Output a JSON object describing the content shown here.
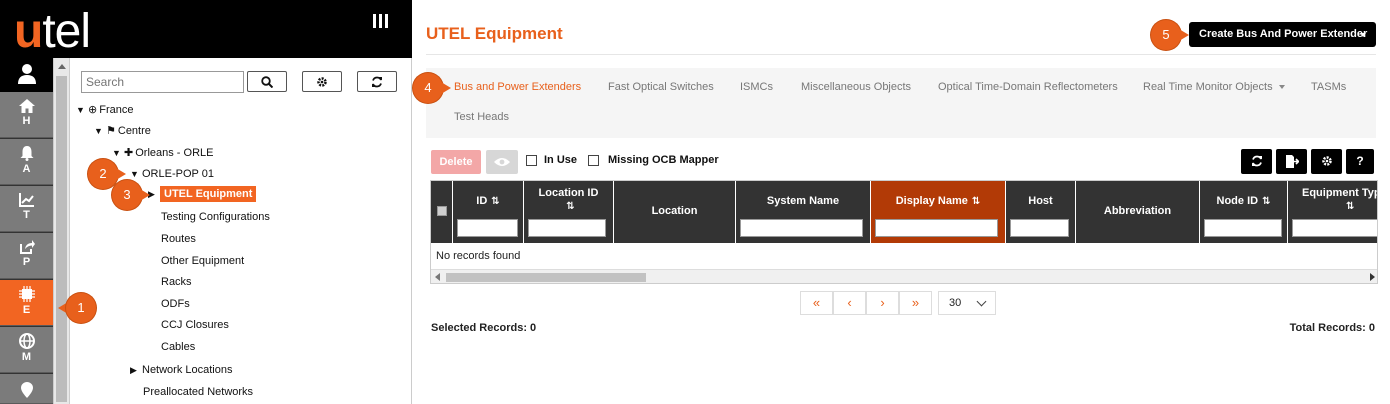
{
  "logo": {
    "u": "u",
    "rest": "tel"
  },
  "rail": {
    "items": [
      {
        "letter": "H",
        "icon": "home-icon",
        "glyph": "⌂"
      },
      {
        "letter": "A",
        "icon": "bell-icon",
        "glyph": "🔔"
      },
      {
        "letter": "T",
        "icon": "chart-icon",
        "glyph": "📈"
      },
      {
        "letter": "P",
        "icon": "share-icon",
        "glyph": "↗"
      },
      {
        "letter": "E",
        "icon": "chip-icon",
        "glyph": "▦"
      },
      {
        "letter": "M",
        "icon": "globe-icon",
        "glyph": "◍"
      },
      {
        "letter": "",
        "icon": "map-pin-icon",
        "glyph": "●"
      }
    ]
  },
  "tree": {
    "search_placeholder": "Search",
    "nodes": {
      "france": "France",
      "centre": "Centre",
      "orleans": "Orleans - ORLE",
      "pop": "ORLE-POP 01",
      "utel_equipment": "UTEL Equipment",
      "testing": "Testing Configurations",
      "routes": "Routes",
      "other": "Other Equipment",
      "racks": "Racks",
      "odfs": "ODFs",
      "ccj": "CCJ Closures",
      "cables": "Cables",
      "network_locations": "Network Locations",
      "preallocated": "Preallocated Networks"
    }
  },
  "main": {
    "title": "UTEL Equipment",
    "create_button": "Create Bus And Power Extender",
    "tabs": [
      "Bus and Power Extenders",
      "Fast Optical Switches",
      "ISMCs",
      "Miscellaneous Objects",
      "Optical Time-Domain Reflectometers",
      "Real Time Monitor Objects",
      "TASMs",
      "Test Heads"
    ],
    "toolbar": {
      "delete": "Delete",
      "in_use": "In Use",
      "missing_ocb": "Missing OCB Mapper",
      "help": "?"
    },
    "columns": {
      "id": "ID",
      "location_id": "Location ID",
      "location": "Location",
      "system_name": "System Name",
      "display_name": "Display Name",
      "host": "Host",
      "abbreviation": "Abbreviation",
      "node_id": "Node ID",
      "equipment_type": "Equipment Type"
    },
    "empty_text": "No records found",
    "pager": {
      "first": "«",
      "prev": "‹",
      "next": "›",
      "last": "»",
      "page_size": "30"
    },
    "selected_records": "Selected Records: 0",
    "total_records": "Total Records: 0"
  },
  "callouts": {
    "c1": "1",
    "c2": "2",
    "c3": "3",
    "c4": "4",
    "c5": "5"
  },
  "colors": {
    "accent": "#f26522",
    "title": "#e8601c",
    "header": "#333333",
    "sorted_header": "#b23a06"
  }
}
